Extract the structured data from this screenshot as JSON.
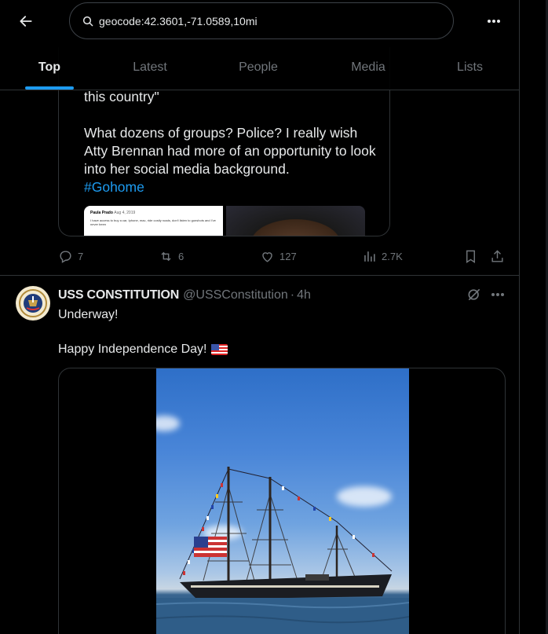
{
  "search": {
    "query": "geocode:42.3601,-71.0589,10mi"
  },
  "tabs": [
    {
      "label": "Top",
      "active": true
    },
    {
      "label": "Latest",
      "active": false
    },
    {
      "label": "People",
      "active": false
    },
    {
      "label": "Media",
      "active": false
    },
    {
      "label": "Lists",
      "active": false
    }
  ],
  "quoted_tweet": {
    "fragment_line": "this country\"",
    "body": "What dozens of groups? Police? I really wish Atty Brennan had more of an opportunity to look into her social media background.",
    "hashtag": "#Gohome",
    "embedded_name": "Paula Prado",
    "embedded_date": "Aug 4, 2019",
    "embedded_text": "I have access to buy a car, Iphone, mac, ride costly roads, don't listen to gunshots and I've never been"
  },
  "tweet1_actions": {
    "replies": "7",
    "reposts": "6",
    "likes": "127",
    "views": "2.7K"
  },
  "tweet2": {
    "name": "USS CONSTITUTION",
    "handle": "@USSConstitution",
    "dot": "·",
    "time": "4h",
    "line1": "Underway!",
    "line2": "Happy Independence Day!"
  },
  "colors": {
    "accent": "#1d9bf0",
    "muted": "#71767b",
    "text": "#e7e9ea",
    "border": "#2f3336"
  }
}
